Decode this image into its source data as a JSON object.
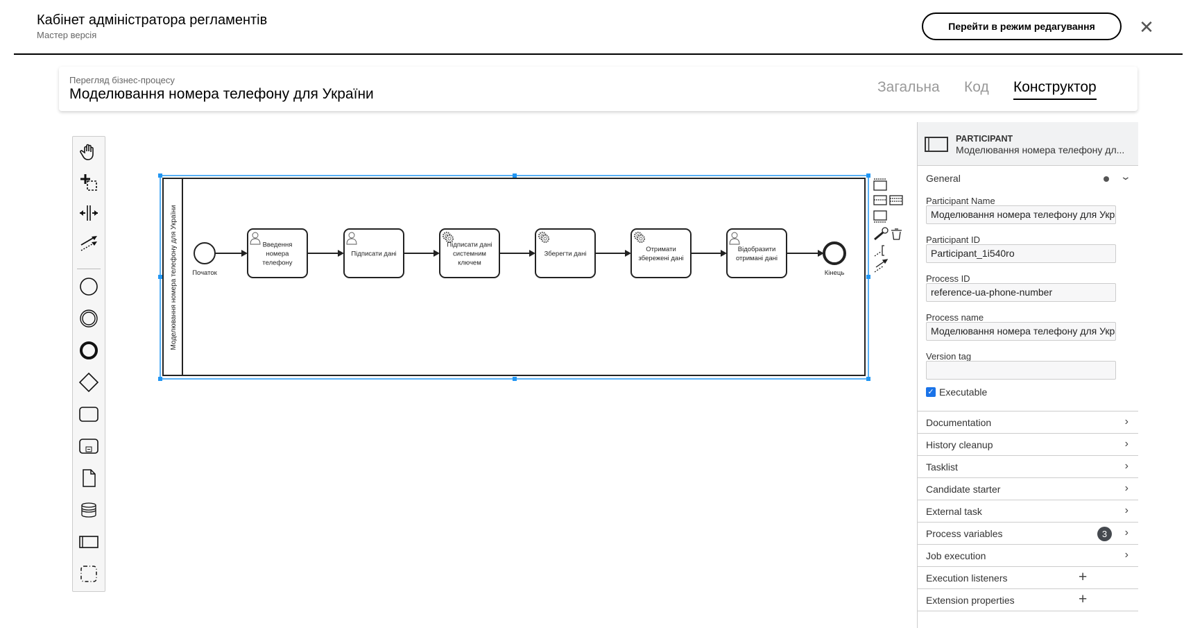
{
  "header": {
    "title": "Кабінет адміністратора регламентів",
    "subtitle": "Мастер версія",
    "edit_button": "Перейти в режим редагування",
    "close_icon": "close-icon"
  },
  "process": {
    "subtitle": "Перегляд бізнес-процесу",
    "title": "Моделювання номера телефону для України",
    "tabs": [
      {
        "label": "Загальна",
        "active": false
      },
      {
        "label": "Код",
        "active": false
      },
      {
        "label": "Конструктор",
        "active": true
      }
    ]
  },
  "toolbar": {
    "tools": [
      "hand-tool",
      "lasso-tool",
      "space-tool",
      "global-connect-tool",
      "start-event",
      "intermediate-event",
      "end-event",
      "gateway",
      "task",
      "subprocess",
      "data-object",
      "data-store",
      "participant",
      "group"
    ]
  },
  "diagram": {
    "pool_label": "Моделювання номера телефону для України",
    "start_label": "Початок",
    "end_label": "Кінець",
    "tasks": [
      {
        "type": "user",
        "lines": [
          "Введення",
          "номера",
          "телефону"
        ]
      },
      {
        "type": "user",
        "lines": [
          "Підписати дані"
        ]
      },
      {
        "type": "service",
        "lines": [
          "Підписати дані",
          "системним",
          "ключем"
        ]
      },
      {
        "type": "service",
        "lines": [
          "Зберегти дані"
        ]
      },
      {
        "type": "service",
        "lines": [
          "Отримати",
          "збережені дані"
        ]
      },
      {
        "type": "user",
        "lines": [
          "Відобразити",
          "отримані дані"
        ]
      }
    ],
    "selection_color": "#2196f3"
  },
  "panel": {
    "type": "PARTICIPANT",
    "name": "Моделювання номера телефону дл...",
    "general": "General",
    "fields": [
      {
        "label": "Participant Name",
        "value": "Моделювання номера телефону для України"
      },
      {
        "label": "Participant ID",
        "value": "Participant_1i540ro"
      },
      {
        "label": "Process ID",
        "value": "reference-ua-phone-number"
      },
      {
        "label": "Process name",
        "value": "Моделювання номера телефону для України"
      },
      {
        "label": "Version tag",
        "value": ""
      }
    ],
    "executable": {
      "label": "Executable",
      "checked": true
    },
    "sections": [
      {
        "label": "Documentation",
        "action": "chevron"
      },
      {
        "label": "History cleanup",
        "action": "chevron"
      },
      {
        "label": "Tasklist",
        "action": "chevron"
      },
      {
        "label": "Candidate starter",
        "action": "chevron"
      },
      {
        "label": "External task",
        "action": "chevron"
      },
      {
        "label": "Process variables",
        "action": "chevron",
        "badge": "3"
      },
      {
        "label": "Job execution",
        "action": "chevron"
      },
      {
        "label": "Execution listeners",
        "action": "plus"
      },
      {
        "label": "Extension properties",
        "action": "plus"
      }
    ]
  }
}
